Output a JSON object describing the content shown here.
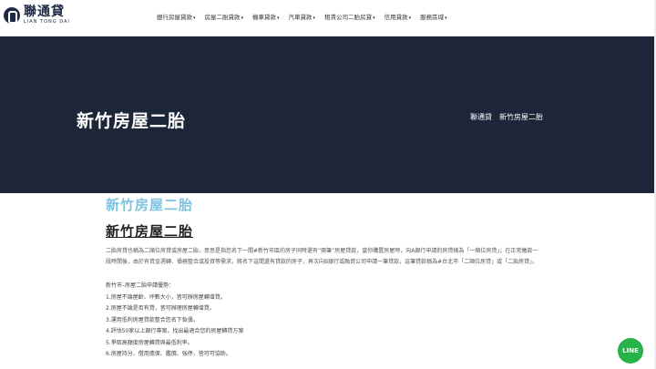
{
  "brand": {
    "name_cn": "聯通貸",
    "name_en": "LIAN TONG DAI"
  },
  "nav": {
    "items": [
      {
        "label": "銀行房屋貸款"
      },
      {
        "label": "房屋二胎貸款"
      },
      {
        "label": "機車貸款"
      },
      {
        "label": "汽車貸款"
      },
      {
        "label": "租賃公司二胎房貸"
      },
      {
        "label": "信用貸款"
      },
      {
        "label": "服務區域"
      }
    ]
  },
  "hero": {
    "title": "新竹房屋二胎",
    "breadcrumb": [
      "聯通貸",
      "新竹房屋二胎"
    ]
  },
  "content": {
    "subtitle": "新竹房屋二胎",
    "title": "新竹房屋二胎",
    "para1": "二胎房貸也稱為二順位房貸或房屋二胎，意思是指您名下一間#新竹市區的房子同時還有“兩筆”房屋貸款，當你購置房屋時，向A銀行申請的房貸稱為「一順位房貸」；在正常繳款一段時間後，由於有資金週轉、債務整合或投資等需求，將名下這間還有貸款的房子，再次向B銀行或融資公司申請一筆貸款，這筆貸款稱為#台北市「二順位房貸」或「二胎房貸」。",
    "list_title": "新竹市–房屋二胎申請優勢：",
    "list": [
      "1.房屋不論屋齡、坪數大小，皆可辦房屋轉增貸。",
      "2.房屋不論是否有貸，皆可辦理房屋轉增貸。",
      "3.運用低利房屋貸款整合您名下負債。",
      "4.評估50家以上銀行專案，找出最適合您的房屋轉貸方案",
      "5.爭取高額度房屋轉貸與最低利率。",
      "6.房屋持分、借用擔保、鑑價、強停，皆可可協助。"
    ]
  },
  "line_button": {
    "label": "LINE"
  }
}
